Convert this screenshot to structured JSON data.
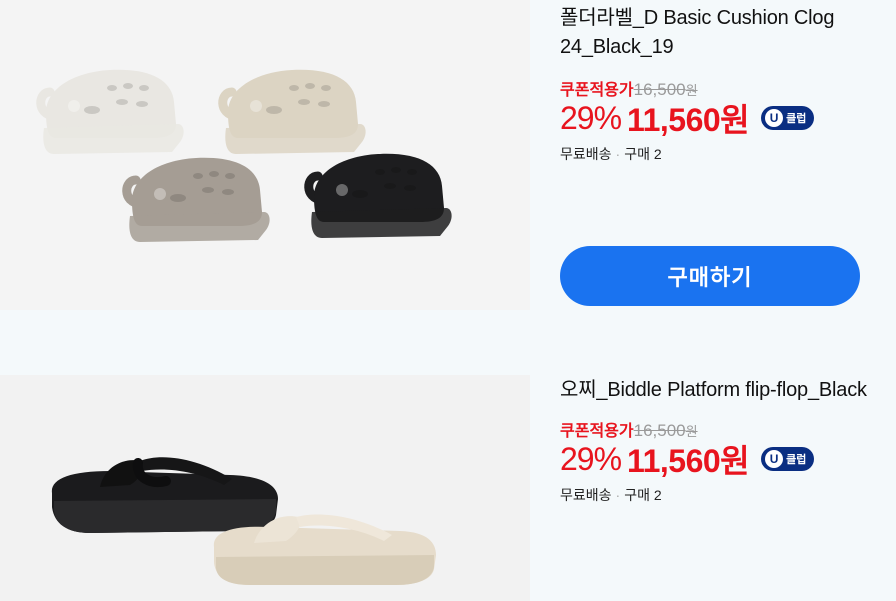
{
  "products": [
    {
      "title": "폴더라벨_D Basic Cushion Clog 24_Black_19",
      "coupon_label": "쿠폰적용가",
      "original_price": "16,500",
      "original_unit": "원",
      "discount": "29%",
      "price": "11,560원",
      "badge_u": "U",
      "badge_text": "클럽",
      "shipping": "무료배송",
      "sep": "·",
      "purchases": "구매 2",
      "buy_label": "구매하기",
      "image_colors": [
        "#e9e7e2",
        "#dcd4c3",
        "#a59d94",
        "#1d1d1f"
      ]
    },
    {
      "title": "오찌_Biddle Platform flip-flop_Black",
      "coupon_label": "쿠폰적용가",
      "original_price": "16,500",
      "original_unit": "원",
      "discount": "29%",
      "price": "11,560원",
      "badge_u": "U",
      "badge_text": "클럽",
      "shipping": "무료배송",
      "sep": "·",
      "purchases": "구매 2",
      "image_colors": [
        "#1b1b1d",
        "#e6dccb"
      ]
    }
  ],
  "colors": {
    "accent_red": "#e8141e",
    "button_blue": "#1a73f0",
    "badge_navy": "#0a2e82"
  }
}
